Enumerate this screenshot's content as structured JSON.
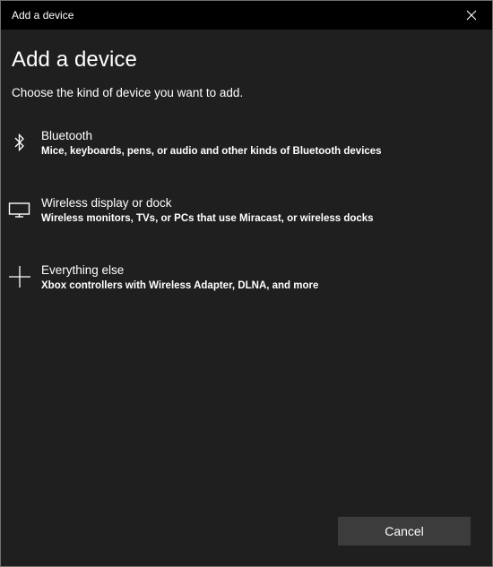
{
  "window": {
    "title": "Add a device"
  },
  "dialog": {
    "heading": "Add a device",
    "subheading": "Choose the kind of device you want to add."
  },
  "options": [
    {
      "icon": "bluetooth-icon",
      "title": "Bluetooth",
      "description": "Mice, keyboards, pens, or audio and other kinds of Bluetooth devices"
    },
    {
      "icon": "monitor-icon",
      "title": "Wireless display or dock",
      "description": "Wireless monitors, TVs, or PCs that use Miracast, or wireless docks"
    },
    {
      "icon": "plus-icon",
      "title": "Everything else",
      "description": "Xbox controllers with Wireless Adapter, DLNA, and more"
    }
  ],
  "buttons": {
    "cancel_label": "Cancel"
  },
  "colors": {
    "titlebar": "#000000",
    "background": "#1f1f1f",
    "button": "#3c3c3c",
    "text": "#ffffff"
  }
}
